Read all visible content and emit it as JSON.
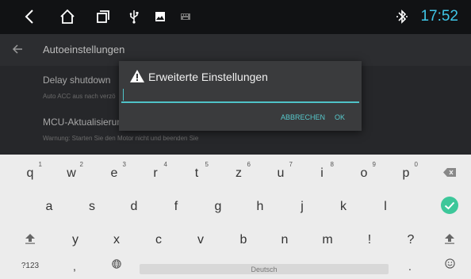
{
  "status_bar": {
    "time": "17:52",
    "icons": [
      "back-icon",
      "home-icon",
      "recent-apps-icon",
      "usb-icon",
      "image-icon",
      "keyboard-icon",
      "bluetooth-icon"
    ],
    "time_color": "#3fc6e7"
  },
  "settings": {
    "title": "Autoeinstellungen",
    "items": [
      {
        "title": "Delay shutdown",
        "subtitle": "Auto ACC aus nach verzö"
      },
      {
        "title": "MCU-Aktualisierung",
        "subtitle": "Warnung: Starten Sie den Motor nicht und beenden Sie"
      }
    ]
  },
  "dialog": {
    "icon": "warning-icon",
    "title": "Erweiterte Einstellungen",
    "input_value": "",
    "cancel_label": "ABBRECHEN",
    "ok_label": "OK",
    "accent_color": "#4fc3c8"
  },
  "keyboard": {
    "row1": [
      {
        "key": "q",
        "hint": "1"
      },
      {
        "key": "w",
        "hint": "2"
      },
      {
        "key": "e",
        "hint": "3"
      },
      {
        "key": "r",
        "hint": "4"
      },
      {
        "key": "t",
        "hint": "5"
      },
      {
        "key": "z",
        "hint": "6"
      },
      {
        "key": "u",
        "hint": "7"
      },
      {
        "key": "i",
        "hint": "8"
      },
      {
        "key": "o",
        "hint": "9"
      },
      {
        "key": "p",
        "hint": "0"
      }
    ],
    "row2": [
      "a",
      "s",
      "d",
      "f",
      "g",
      "h",
      "j",
      "k",
      "l"
    ],
    "row3": [
      "y",
      "x",
      "c",
      "v",
      "b",
      "n",
      "m",
      "!",
      "?"
    ],
    "symbols_label": "?123",
    "comma": ",",
    "space_label": "Deutsch",
    "period": ".",
    "icons": [
      "backspace-icon",
      "enter-check-icon",
      "shift-icon",
      "globe-icon",
      "emoji-icon"
    ],
    "enter_color": "#3dc79a"
  }
}
